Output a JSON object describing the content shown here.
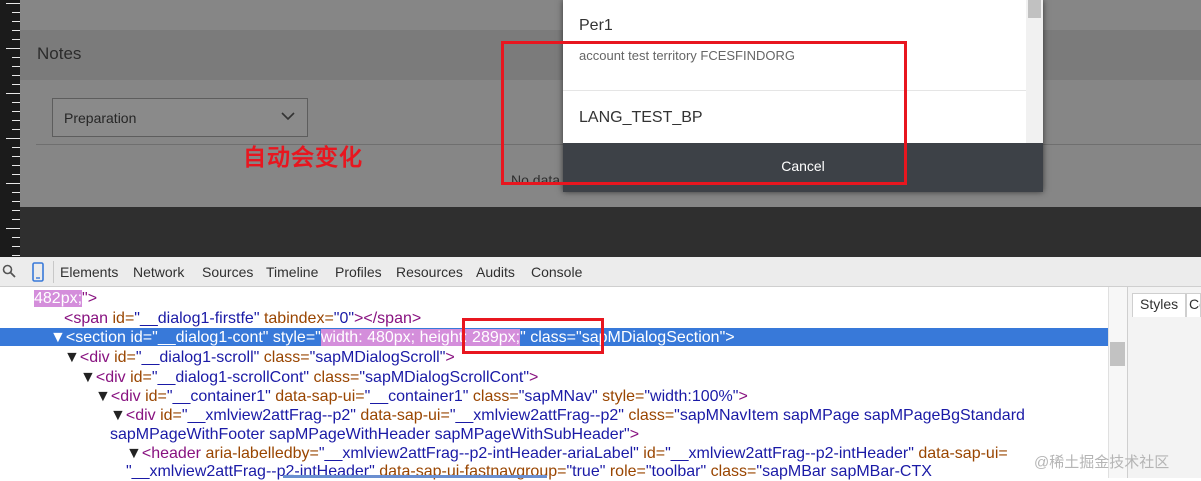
{
  "app": {
    "notes_title": "Notes",
    "select_value": "Preparation",
    "no_data_text": "No data",
    "annotation_text": "自动会变化"
  },
  "dialog": {
    "items": [
      {
        "title": "Per1",
        "description": "account test territory FCESFINDORG"
      },
      {
        "title": "LANG_TEST_BP"
      }
    ],
    "cancel_label": "Cancel"
  },
  "devtools": {
    "tabs": [
      "Elements",
      "Network",
      "Sources",
      "Timeline",
      "Profiles",
      "Resources",
      "Audits",
      "Console"
    ],
    "side_tabs": {
      "styles": "Styles",
      "computed": "Co"
    },
    "code": {
      "line0": "482px;",
      "line0_end": "\">",
      "line1_tag": "<span",
      "line1_id_attr": " id=",
      "line1_id_val": "\"__dialog1-firstfe\"",
      "line1_tab_attr": " tabindex=",
      "line1_tab_val": "\"0\"",
      "line1_close": "></span>",
      "line2_tag": "<section",
      "line2_id_attr": " id=",
      "line2_id_val": "\"__dialog1-cont\"",
      "line2_style_attr": " style=",
      "line2_style_q": "\"",
      "line2_width": "width: 480px;",
      "line2_height": " height: 289px;",
      "line2_style_q2": "\"",
      "line2_class_attr": " class=",
      "line2_class_val": "\"sapMDialogSection\"",
      "line2_close": ">",
      "line3_tag": "<div",
      "line3_id_attr": " id=",
      "line3_id_val": "\"__dialog1-scroll\"",
      "line3_class_attr": " class=",
      "line3_class_val": "\"sapMDialogScroll\"",
      "line3_close": ">",
      "line4_tag": "<div",
      "line4_id_attr": " id=",
      "line4_id_val": "\"__dialog1-scrollCont\"",
      "line4_class_attr": " class=",
      "line4_class_val": "\"sapMDialogScrollCont\"",
      "line4_close": ">",
      "line5_tag": "<div",
      "line5_id_attr": " id=",
      "line5_id_val": "\"__container1\"",
      "line5_ui_attr": " data-sap-ui=",
      "line5_ui_val": "\"__container1\"",
      "line5_class_attr": " class=",
      "line5_class_val": "\"sapMNav\"",
      "line5_style_attr": " style=",
      "line5_style_val": "\"width:100%\"",
      "line5_close": ">",
      "line6_tag": "<div",
      "line6_id_attr": " id=",
      "line6_id_val": "\"__xmlview2attFrag--p2\"",
      "line6_ui_attr": " data-sap-ui=",
      "line6_ui_val": "\"__xmlview2attFrag--p2\"",
      "line6_class_attr": " class=",
      "line6_class_val": "\"sapMNavItem sapMPage sapMPageBgStandard",
      "line7_text": "sapMPageWithFooter sapMPageWithHeader sapMPageWithSubHeader\"",
      "line7_close": ">",
      "line8_tag": "<header",
      "line8_al_attr": " aria-labelledby=",
      "line8_al_val": "\"__xmlview2attFrag--p2-intHeader-ariaLabel\"",
      "line8_id_attr": " id=",
      "line8_id_val": "\"__xmlview2attFrag--p2-intHeader\"",
      "line8_ui_attr": " data-sap-ui=",
      "line9_text": "\"__xmlview2attFrag--p2-intHeader\"",
      "line9_fng_attr": " data-sap-ui-fastnavgroup=",
      "line9_fng_val": "\"true\"",
      "line9_role_attr": " role=",
      "line9_role_val": "\"toolbar\"",
      "line9_class_attr": " class=",
      "line9_class_val": "\"sapMBar sapMBar-CTX"
    }
  },
  "watermark": "@稀土掘金技术社区",
  "colors": {
    "annotation_red": "#e8161f",
    "selection_blue": "#3879d9",
    "highlight_pink": "#d48edb",
    "cancel_bar": "#3d4147"
  }
}
